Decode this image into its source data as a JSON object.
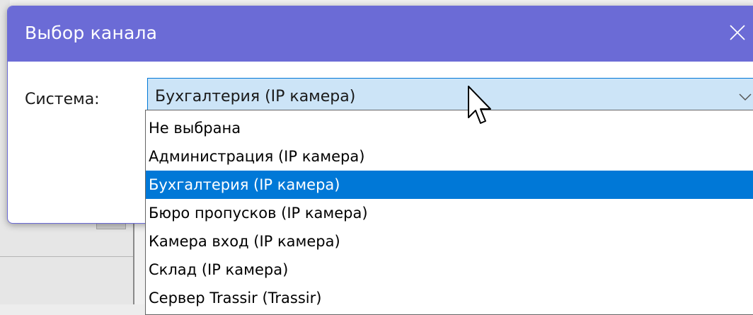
{
  "dialog": {
    "title": "Выбор канала",
    "close_icon": "close-icon",
    "system_label": "Система:",
    "system_select": {
      "value": "Бухгалтерия (IP камера)",
      "options": [
        "Не выбрана",
        "Администрация (IP камера)",
        "Бухгалтерия (IP камера)",
        "Бюро пропусков (IP камера)",
        "Камера вход (IP камера)",
        "Склад (IP камера)",
        "Сервер Trassir (Trassir)"
      ],
      "selected_index": 2
    }
  },
  "colors": {
    "titlebar": "#6b6bd6",
    "selection": "#0078d7",
    "select_bg": "#cce4f7"
  }
}
